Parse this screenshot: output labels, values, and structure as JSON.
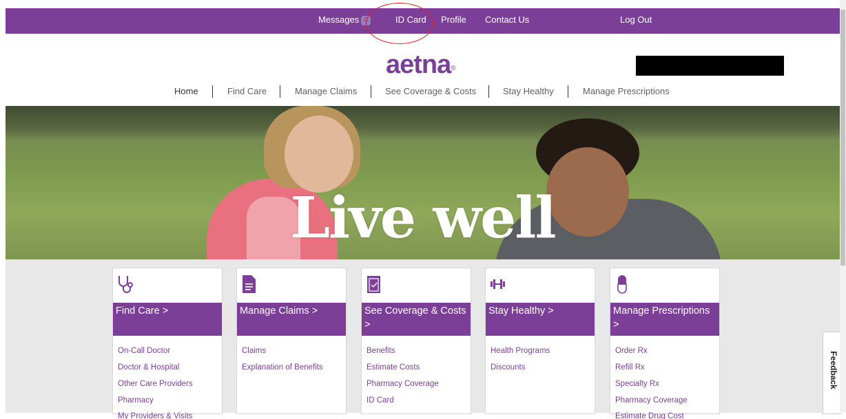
{
  "topbar": {
    "messages_label": "Messages",
    "messages_count": "0",
    "id_card_label": "ID Card",
    "profile_label": "Profile",
    "contact_label": "Contact Us",
    "logout_label": "Log Out"
  },
  "brand": {
    "logo_text": "aetna",
    "trademark": "®",
    "accent_color": "#7b3f98"
  },
  "mainnav": [
    {
      "label": "Home"
    },
    {
      "label": "Find Care"
    },
    {
      "label": "Manage Claims"
    },
    {
      "label": "See Coverage & Costs"
    },
    {
      "label": "Stay Healthy"
    },
    {
      "label": "Manage Prescriptions"
    }
  ],
  "hero": {
    "title": "Live well"
  },
  "cards": [
    {
      "icon": "stethoscope-icon",
      "title": "Find Care >",
      "links": [
        "On-Call Doctor",
        "Doctor & Hospital",
        "Other Care Providers",
        "Pharmacy",
        "My Providers & Visits"
      ]
    },
    {
      "icon": "document-icon",
      "title": "Manage Claims >",
      "links": [
        "Claims",
        "Explanation of Benefits"
      ]
    },
    {
      "icon": "clipboard-icon",
      "title": "See Coverage & Costs >",
      "links": [
        "Benefits",
        "Estimate Costs",
        "Pharmacy Coverage",
        "ID Card"
      ]
    },
    {
      "icon": "dumbbell-icon",
      "title": "Stay Healthy >",
      "links": [
        "Health Programs",
        "Discounts"
      ]
    },
    {
      "icon": "pill-icon",
      "title": "Manage Prescriptions >",
      "links": [
        "Order Rx",
        "Refill Rx",
        "Specialty Rx",
        "Pharmacy Coverage",
        "Estimate Drug Cost"
      ]
    }
  ],
  "feedback": {
    "label": "Feedback"
  }
}
